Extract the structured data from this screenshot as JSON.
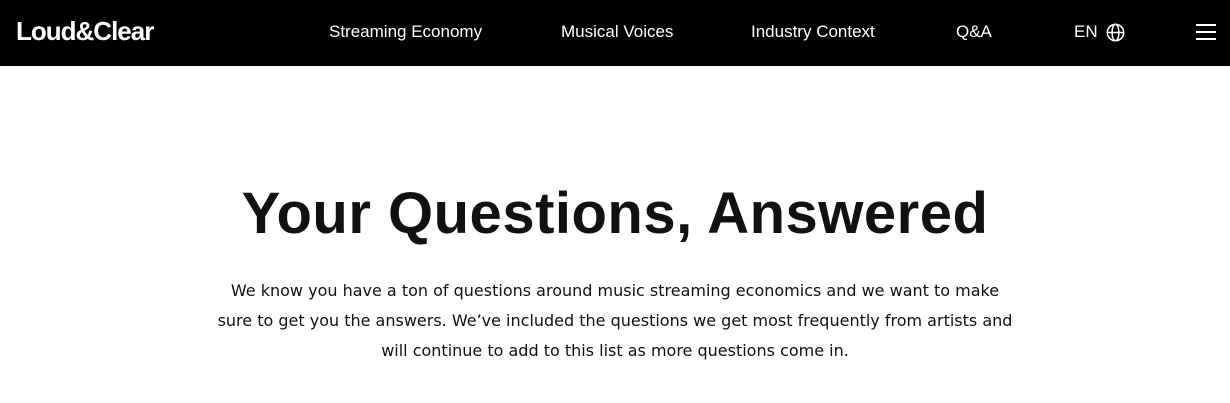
{
  "header": {
    "logo": "Loud&Clear",
    "nav": [
      {
        "label": "Streaming Economy"
      },
      {
        "label": "Musical Voices"
      },
      {
        "label": "Industry Context"
      },
      {
        "label": "Q&A"
      }
    ],
    "language": {
      "label": "EN",
      "icon": "globe-icon"
    },
    "menu": {
      "icon": "hamburger-menu-icon"
    }
  },
  "hero": {
    "title": "Your Questions, Answered",
    "intro": "We know you have a ton of questions around music streaming economics and we want to make sure to get you the answers. We’ve included the questions we get most frequently from artists and will continue to add to this list as more questions come in."
  },
  "colors": {
    "header_background": "#000000",
    "header_text": "#ffffff",
    "page_background": "#ffffff",
    "body_text": "#111111"
  }
}
